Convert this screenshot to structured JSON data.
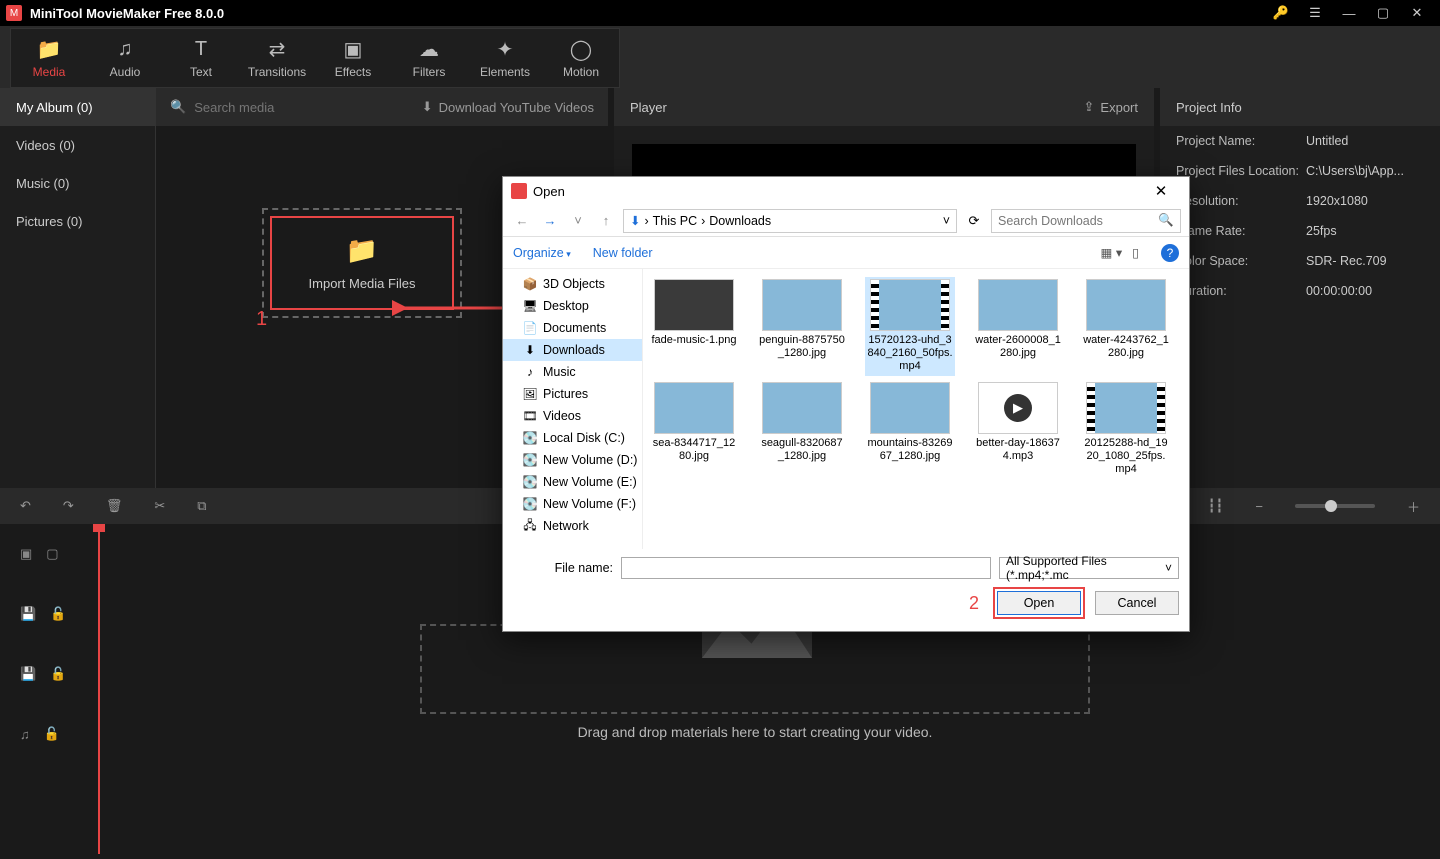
{
  "app": {
    "title": "MiniTool MovieMaker Free 8.0.0"
  },
  "tabs": [
    {
      "label": "Media",
      "icon": "📁"
    },
    {
      "label": "Audio",
      "icon": "♫"
    },
    {
      "label": "Text",
      "icon": "T"
    },
    {
      "label": "Transitions",
      "icon": "⇄"
    },
    {
      "label": "Effects",
      "icon": "▣"
    },
    {
      "label": "Filters",
      "icon": "☁"
    },
    {
      "label": "Elements",
      "icon": "✦"
    },
    {
      "label": "Motion",
      "icon": "◯"
    }
  ],
  "sidebar": {
    "items": [
      {
        "label": "My Album (0)"
      },
      {
        "label": "Videos (0)"
      },
      {
        "label": "Music (0)"
      },
      {
        "label": "Pictures (0)"
      }
    ]
  },
  "search": {
    "placeholder": "Search media",
    "download": "Download YouTube Videos"
  },
  "import": {
    "label": "Import Media Files"
  },
  "annotation": {
    "num1": "1",
    "num2": "2"
  },
  "player": {
    "title": "Player",
    "export": "Export"
  },
  "project": {
    "title": "Project Info",
    "rows": [
      {
        "k": "Project Name:",
        "v": "Untitled"
      },
      {
        "k": "Project Files Location:",
        "v": "C:\\Users\\bj\\App..."
      },
      {
        "k": "Resolution:",
        "v": "1920x1080"
      },
      {
        "k": "Frame Rate:",
        "v": "25fps"
      },
      {
        "k": "Color Space:",
        "v": "SDR- Rec.709"
      },
      {
        "k": "Duration:",
        "v": "00:00:00:00"
      }
    ]
  },
  "timeline": {
    "drop": "Drag and drop materials here to start creating your video."
  },
  "dialog": {
    "title": "Open",
    "breadcrumb": [
      "This PC",
      "Downloads"
    ],
    "searchPlaceholder": "Search Downloads",
    "organize": "Organize",
    "newfolder": "New folder",
    "tree": [
      {
        "label": "3D Objects",
        "icon": "📦"
      },
      {
        "label": "Desktop",
        "icon": "🖥"
      },
      {
        "label": "Documents",
        "icon": "📄"
      },
      {
        "label": "Downloads",
        "icon": "⬇",
        "sel": true
      },
      {
        "label": "Music",
        "icon": "♪"
      },
      {
        "label": "Pictures",
        "icon": "🖼"
      },
      {
        "label": "Videos",
        "icon": "🎞"
      },
      {
        "label": "Local Disk (C:)",
        "icon": "💽"
      },
      {
        "label": "New Volume (D:)",
        "icon": "💽"
      },
      {
        "label": "New Volume (E:)",
        "icon": "💽"
      },
      {
        "label": "New Volume (F:)",
        "icon": "💽"
      },
      {
        "label": "Network",
        "icon": "🖧"
      }
    ],
    "files": [
      {
        "name": "fade-music-1.png",
        "type": "img",
        "dark": true
      },
      {
        "name": "penguin-8875750_1280.jpg",
        "type": "img"
      },
      {
        "name": "15720123-uhd_3840_2160_50fps.mp4",
        "type": "vid",
        "sel": true
      },
      {
        "name": "water-2600008_1280.jpg",
        "type": "img"
      },
      {
        "name": "water-4243762_1280.jpg",
        "type": "img"
      },
      {
        "name": "sea-8344717_1280.jpg",
        "type": "img"
      },
      {
        "name": "seagull-8320687_1280.jpg",
        "type": "img"
      },
      {
        "name": "mountains-8326967_1280.jpg",
        "type": "img"
      },
      {
        "name": "better-day-186374.mp3",
        "type": "audio"
      },
      {
        "name": "20125288-hd_1920_1080_25fps.mp4",
        "type": "vid"
      }
    ],
    "fileNameLabel": "File name:",
    "fileType": "All Supported Files (*.mp4;*.mc",
    "open": "Open",
    "cancel": "Cancel"
  }
}
